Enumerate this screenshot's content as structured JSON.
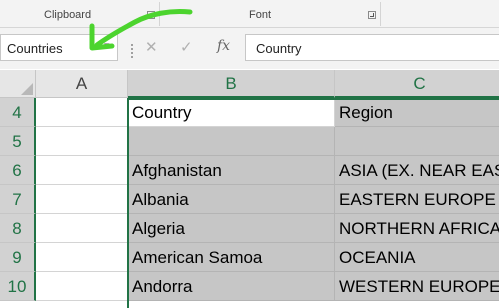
{
  "ribbon": {
    "groups": [
      {
        "label": "Clipboard"
      },
      {
        "label": "Font"
      }
    ]
  },
  "formula_bar": {
    "name_box": "Countries",
    "cancel_glyph": "✕",
    "enter_glyph": "✓",
    "fx_label": "fx",
    "content": "Country"
  },
  "sheet": {
    "columns": [
      "A",
      "B",
      "C"
    ],
    "selected_columns": [
      "B",
      "C"
    ],
    "rows": [
      {
        "num": "4",
        "a": "",
        "b": "Country",
        "c": "Region"
      },
      {
        "num": "5",
        "a": "",
        "b": "",
        "c": ""
      },
      {
        "num": "6",
        "a": "",
        "b": "Afghanistan",
        "c": "ASIA (EX. NEAR EAST)"
      },
      {
        "num": "7",
        "a": "",
        "b": "Albania",
        "c": "EASTERN EUROPE"
      },
      {
        "num": "8",
        "a": "",
        "b": "Algeria",
        "c": "NORTHERN AFRICA"
      },
      {
        "num": "9",
        "a": "",
        "b": "American Samoa",
        "c": "OCEANIA"
      },
      {
        "num": "10",
        "a": "",
        "b": "Andorra",
        "c": "WESTERN EUROPE"
      }
    ]
  },
  "colors": {
    "accent": "#217346",
    "annotation": "#4cd42e",
    "selection_fill": "#c6c6c6"
  }
}
